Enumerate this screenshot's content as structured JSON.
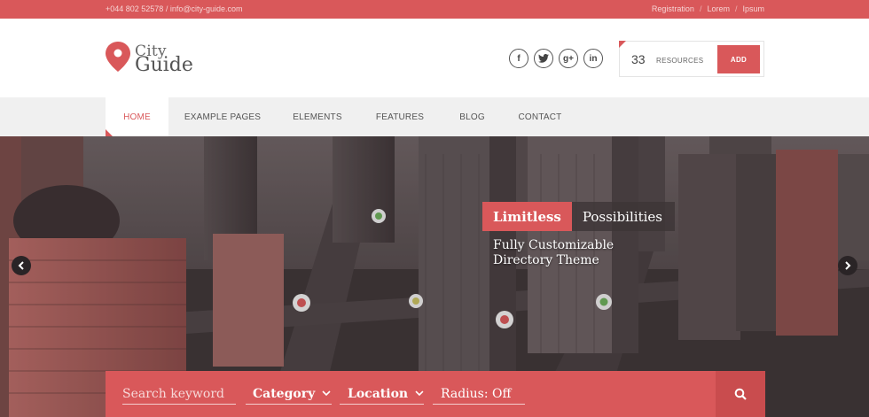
{
  "topbar": {
    "contact": "+044 802 52578 / info@city-guide.com",
    "links": [
      "Registration",
      "Lorem",
      "Ipsum"
    ],
    "separator": "/"
  },
  "logo": {
    "line1": "City",
    "line2": "Guide"
  },
  "social": [
    {
      "name": "facebook-icon",
      "glyph": "f"
    },
    {
      "name": "twitter-icon",
      "glyph": ""
    },
    {
      "name": "google-plus-icon",
      "glyph": "g+"
    },
    {
      "name": "linkedin-icon",
      "glyph": "in"
    }
  ],
  "resources": {
    "count": "33",
    "label": "RESOURCES",
    "add_label": "ADD"
  },
  "nav": {
    "items": [
      {
        "label": "HOME",
        "active": true
      },
      {
        "label": "EXAMPLE PAGES",
        "active": false
      },
      {
        "label": "ELEMENTS",
        "active": false
      },
      {
        "label": "FEATURES",
        "active": false
      },
      {
        "label": "BLOG",
        "active": false
      },
      {
        "label": "CONTACT",
        "active": false
      }
    ]
  },
  "hero": {
    "title_highlight": "Limitless",
    "title_rest": "Possibilities",
    "subtitle_line1": "Fully Customizable",
    "subtitle_line2": "Directory Theme"
  },
  "search": {
    "keyword_placeholder": "Search keyword",
    "category_label": "Category",
    "location_label": "Location",
    "radius_label": "Radius: Off"
  },
  "colors": {
    "accent": "#d9585a",
    "accent_dark": "#c94c4e",
    "nav_bg": "#f0f0f0"
  }
}
